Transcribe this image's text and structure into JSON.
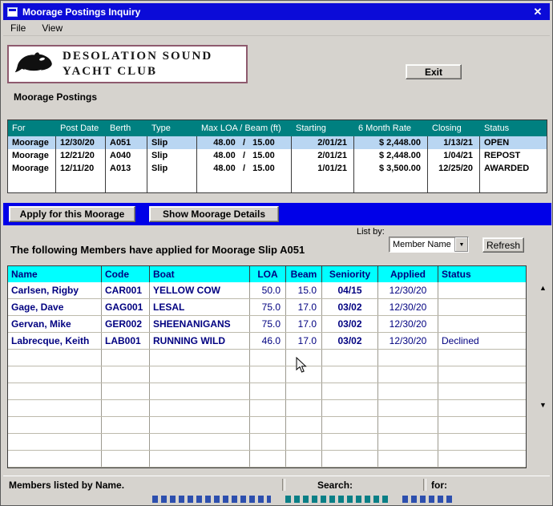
{
  "window": {
    "title": "Moorage Postings Inquiry"
  },
  "icons": {
    "close": "✕",
    "dropdown_arrow": "▼",
    "scroll_up": "▲",
    "scroll_down": "▼"
  },
  "menu": {
    "items": [
      "File",
      "View"
    ]
  },
  "logo": {
    "line1": "DESOLATION SOUND",
    "line2": "YACHT CLUB"
  },
  "exit_button": "Exit",
  "section_label": "Moorage Postings",
  "postings": {
    "headers": [
      "For",
      "Post Date",
      "Berth",
      "Type",
      "Max LOA / Beam (ft)",
      "Starting",
      "6 Month Rate",
      "Closing",
      "Status"
    ],
    "rows": [
      {
        "for": "Moorage",
        "post_date": "12/30/20",
        "berth": "A051",
        "type": "Slip",
        "loa_beam": "48.00   /   15.00",
        "starting": "2/01/21",
        "rate": "$ 2,448.00",
        "closing": "1/13/21",
        "status": "OPEN"
      },
      {
        "for": "Moorage",
        "post_date": "12/21/20",
        "berth": "A040",
        "type": "Slip",
        "loa_beam": "48.00   /   15.00",
        "starting": "2/01/21",
        "rate": "$ 2,448.00",
        "closing": "1/04/21",
        "status": "REPOST"
      },
      {
        "for": "Moorage",
        "post_date": "12/11/20",
        "berth": "A013",
        "type": "Slip",
        "loa_beam": "48.00   /   15.00",
        "starting": "1/01/21",
        "rate": "$ 3,500.00",
        "closing": "12/25/20",
        "status": "AWARDED"
      }
    ]
  },
  "actions": {
    "apply": "Apply for this Moorage",
    "details": "Show Moorage Details"
  },
  "applicants": {
    "heading": "The following Members have applied for Moorage Slip A051",
    "list_by_label": "List by:",
    "list_by_value": "Member Name",
    "refresh_button": "Refresh",
    "headers": [
      "Name",
      "Code",
      "Boat",
      "LOA",
      "Beam",
      "Seniority",
      "Applied",
      "Status"
    ],
    "rows": [
      {
        "name": "Carlsen, Rigby",
        "code": "CAR001",
        "boat": "YELLOW COW",
        "loa": "50.0",
        "beam": "15.0",
        "seniority": "04/15",
        "applied": "12/30/20",
        "status": ""
      },
      {
        "name": "Gage, Dave",
        "code": "GAG001",
        "boat": "LESAL",
        "loa": "75.0",
        "beam": "17.0",
        "seniority": "03/02",
        "applied": "12/30/20",
        "status": ""
      },
      {
        "name": "Gervan, Mike",
        "code": "GER002",
        "boat": "SHEENANIGANS",
        "loa": "75.0",
        "beam": "17.0",
        "seniority": "03/02",
        "applied": "12/30/20",
        "status": ""
      },
      {
        "name": "Labrecque, Keith",
        "code": "LAB001",
        "boat": "RUNNING WILD",
        "loa": "46.0",
        "beam": "17.0",
        "seniority": "03/02",
        "applied": "12/30/20",
        "status": "Declined"
      }
    ]
  },
  "status_bar": {
    "left": "Members listed by Name.",
    "search_label": "Search:",
    "for_label": "for:"
  },
  "colors": {
    "titlebar": "#0b0bd8",
    "postings_header_teal": "#008080",
    "banner_blue": "#0000e8",
    "members_header_cyan": "#00ffff",
    "navy_text": "#000080",
    "selected_row": "#b9d6f2",
    "logo_border": "#8e5a6e"
  }
}
